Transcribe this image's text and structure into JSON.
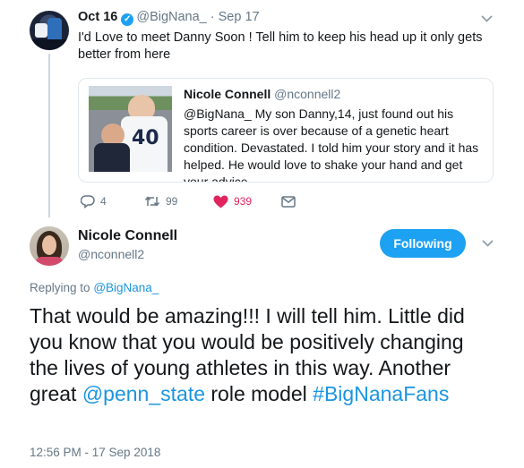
{
  "original_tweet": {
    "display_name": "Oct 16",
    "handle": "@BigNana_",
    "date": "· Sep 17",
    "text": "I'd Love to meet Danny Soon ! Tell him to keep his head up it only gets better from here"
  },
  "quoted_tweet": {
    "display_name": "Nicole Connell",
    "handle": "@nconnell2",
    "image_jersey_number": "40",
    "text": "@BigNana_ My son Danny,14, just found out his sports career is over because of a genetic heart condition. Devastated. I told him your story and it has helped. He would love to shake your hand and get your advice..."
  },
  "actions": {
    "replies": "4",
    "retweets": "99",
    "likes": "939",
    "like_color": "#e0245e"
  },
  "reply_tweet": {
    "display_name": "Nicole Connell",
    "handle": "@nconnell2",
    "follow_label": "Following",
    "replying_prefix": "Replying to",
    "replying_to": "@BigNana_",
    "text_part1": "That would be amazing!!! I will tell him. Little did you know that you would be positively changing the lives of young athletes in this way. Another great ",
    "mention": "@penn_state",
    "text_part2": " role model ",
    "hashtag": "#BigNanaFans",
    "timestamp": "12:56 PM - 17 Sep 2018"
  },
  "colors": {
    "accent": "#1da1f2",
    "link": "#1b95e0",
    "muted": "#657786"
  },
  "icons": [
    "verified-badge-icon",
    "chevron-down-icon",
    "reply-icon",
    "retweet-icon",
    "heart-icon",
    "direct-message-icon"
  ]
}
